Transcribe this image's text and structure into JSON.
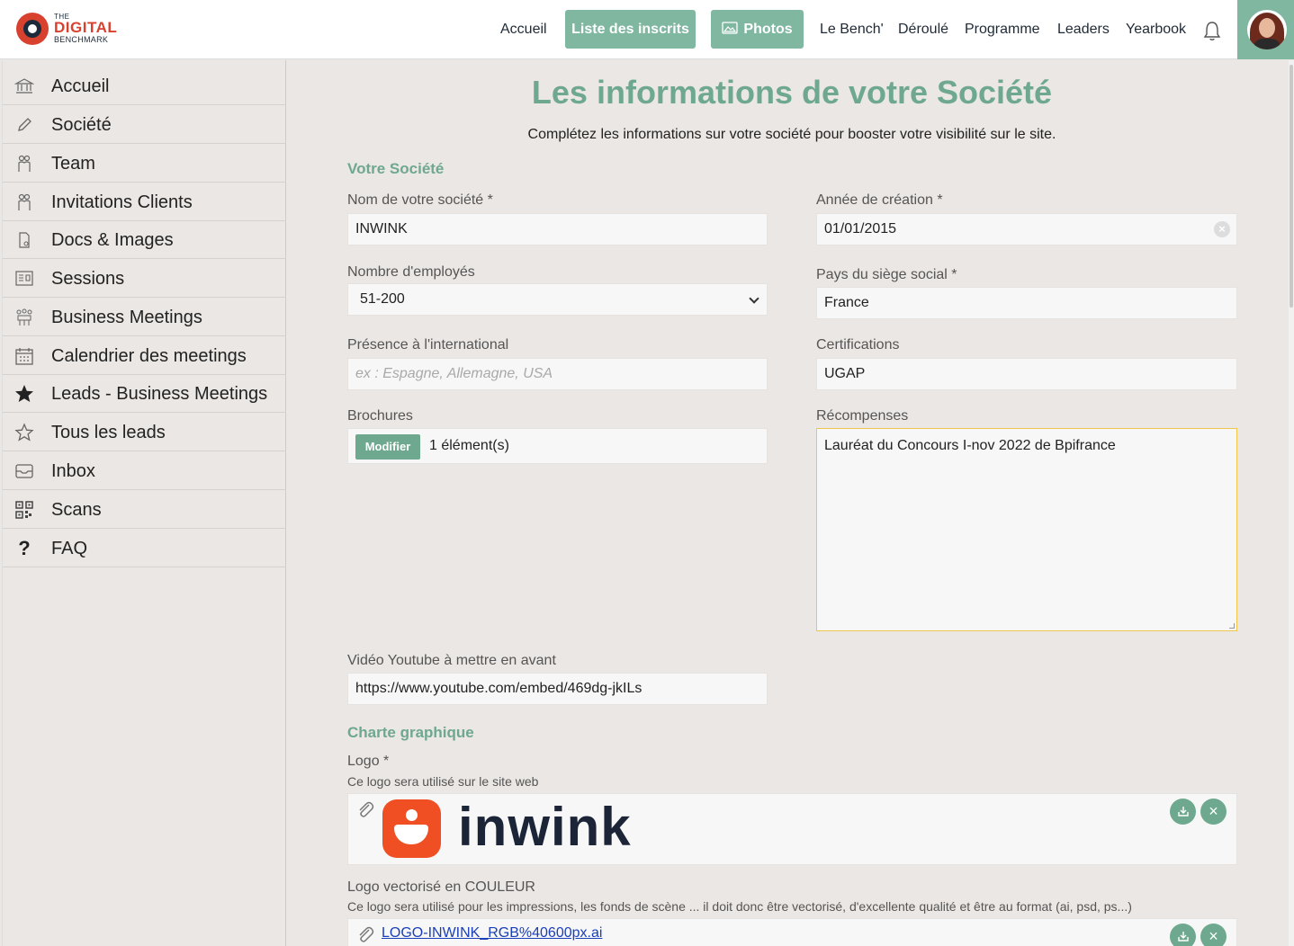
{
  "brand": {
    "the": "THE",
    "digital": "DIGITAL",
    "benchmark": "BENCHMARK"
  },
  "nav": {
    "accueil": "Accueil",
    "inscrits": "Liste des inscrits",
    "photos": "Photos",
    "bench": "Le Bench'",
    "deroule": "Déroulé",
    "programme": "Programme",
    "leaders": "Leaders",
    "yearbook": "Yearbook"
  },
  "sidebar": {
    "items": [
      {
        "label": "Accueil",
        "icon": "bank-icon"
      },
      {
        "label": "Société",
        "icon": "pencil-icon"
      },
      {
        "label": "Team",
        "icon": "people-icon"
      },
      {
        "label": "Invitations Clients",
        "icon": "people-icon"
      },
      {
        "label": "Docs & Images",
        "icon": "document-icon"
      },
      {
        "label": "Sessions",
        "icon": "sessions-icon"
      },
      {
        "label": "Business Meetings",
        "icon": "meeting-icon"
      },
      {
        "label": "Calendrier des meetings",
        "icon": "calendar-icon"
      },
      {
        "label": "Leads - Business Meetings",
        "icon": "star-filled-icon"
      },
      {
        "label": "Tous les leads",
        "icon": "star-outline-icon"
      },
      {
        "label": "Inbox",
        "icon": "inbox-icon"
      },
      {
        "label": "Scans",
        "icon": "qrcode-icon"
      },
      {
        "label": "FAQ",
        "icon": "question-icon"
      }
    ]
  },
  "main": {
    "title": "Les informations de votre Société",
    "subtitle": "Complétez les informations sur votre société pour booster votre visibilité sur le site.",
    "section_company": "Votre Société",
    "section_charte": "Charte graphique"
  },
  "form": {
    "company_name_label": "Nom de votre société *",
    "company_name_value": "INWINK",
    "year_label": "Année de création *",
    "year_value": "01/01/2015",
    "employees_label": "Nombre d'employés",
    "employees_value": "51-200",
    "hq_label": "Pays du siège social *",
    "hq_value": "France",
    "international_label": "Présence à l'international",
    "international_placeholder": "ex : Espagne, Allemagne, USA",
    "certifications_label": "Certifications",
    "certifications_value": "UGAP",
    "brochures_label": "Brochures",
    "brochures_button": "Modifier",
    "brochures_count": "1 élément(s)",
    "awards_label": "Récompenses",
    "awards_value": "Lauréat du Concours I-nov 2022 de Bpifrance",
    "video_label": "Vidéo Youtube à mettre en avant",
    "video_value": "https://www.youtube.com/embed/469dg-jkILs",
    "logo_label": "Logo *",
    "logo_hint": "Ce logo sera utilisé sur le site web",
    "logo_word": "inwink",
    "vector_label": "Logo vectorisé en COULEUR",
    "vector_hint": "Ce logo sera utilisé pour les impressions, les fonds de scène ... il doit donc être vectorisé, d'excellente qualité et être au format (ai, psd, ps...)",
    "vector_file": "LOGO-INWINK_RGB%40600px.ai"
  },
  "colors": {
    "accent": "#6ea88f",
    "nav_button": "#7fb7a1",
    "brand_red": "#d9412f",
    "inwink_orange": "#f04e23"
  }
}
